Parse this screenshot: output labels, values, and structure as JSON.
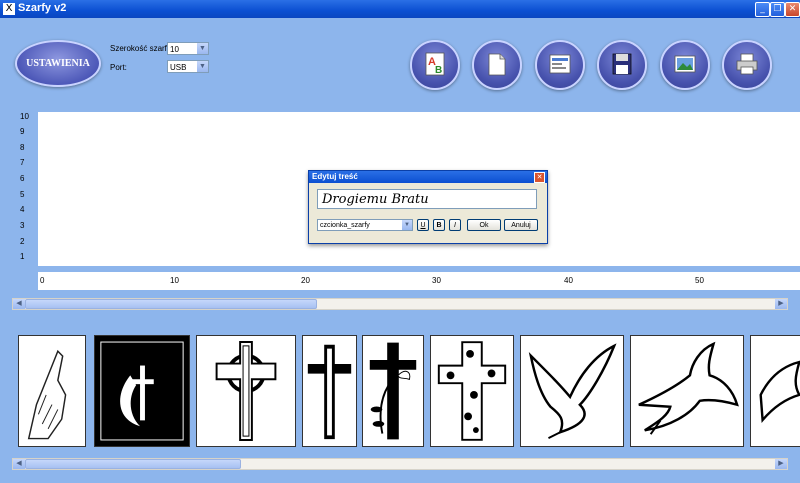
{
  "window": {
    "title": "Szarfy v2",
    "icon": "ribbon-icon"
  },
  "toolbar": {
    "settings_label": "USTAWIENIA",
    "width_label": "Szerokość szarfy:",
    "width_value": "10",
    "port_label": "Port:",
    "port_value": "USB",
    "tools": [
      "font-text-icon",
      "new-document-icon",
      "open-document-icon",
      "save-disk-icon",
      "image-insert-icon",
      "printer-icon"
    ]
  },
  "ruler": {
    "vertical": [
      "10",
      "9",
      "8",
      "7",
      "6",
      "5",
      "4",
      "3",
      "2",
      "1"
    ],
    "horizontal": [
      "0",
      "10",
      "20",
      "30",
      "40",
      "50"
    ]
  },
  "dialog": {
    "title": "Edytuj treść",
    "text": "Drogiemu Bratu",
    "font": "czcionka_szarfy",
    "underline": "U",
    "bold": "B",
    "italic": "I",
    "ok": "Ok",
    "cancel": "Anuluj"
  },
  "gallery": [
    "praying-hands",
    "church-cross-flame",
    "celtic-cross",
    "latin-cross",
    "cross-with-lily",
    "flower-cross",
    "dove-olive-branch",
    "dove-flying",
    "dove-partial"
  ],
  "colors": {
    "background": "#8db5ec",
    "titlebar": "#0b4fd1",
    "accent_button": "#4752ad"
  }
}
